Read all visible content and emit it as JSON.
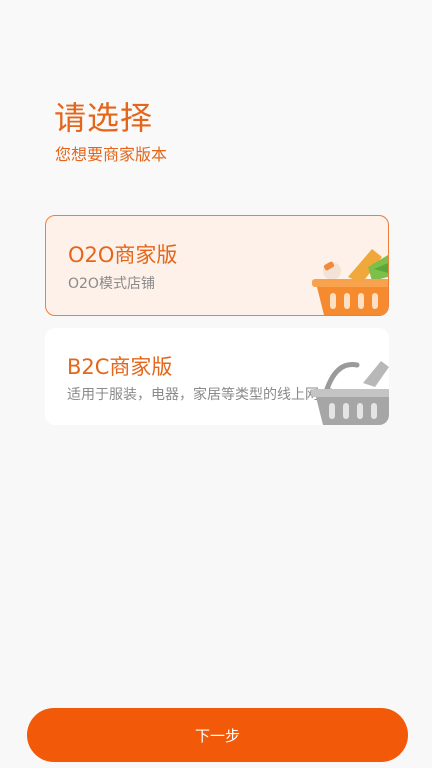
{
  "header": {
    "title": "请选择",
    "subtitle": "您想要商家版本"
  },
  "options": [
    {
      "title": "O2O商家版",
      "description": "O2O模式店铺",
      "selected": true,
      "icon": "basket-orange-icon"
    },
    {
      "title": "B2C商家版",
      "description": "适用于服装，电器，家居等类型的线上网点",
      "selected": false,
      "icon": "basket-gray-icon"
    }
  ],
  "footer": {
    "next_label": "下一步"
  },
  "colors": {
    "accent": "#e4661b",
    "button": "#f25a0a",
    "selected_bg": "#fdf1ea",
    "selected_border": "#ef7f3a"
  }
}
